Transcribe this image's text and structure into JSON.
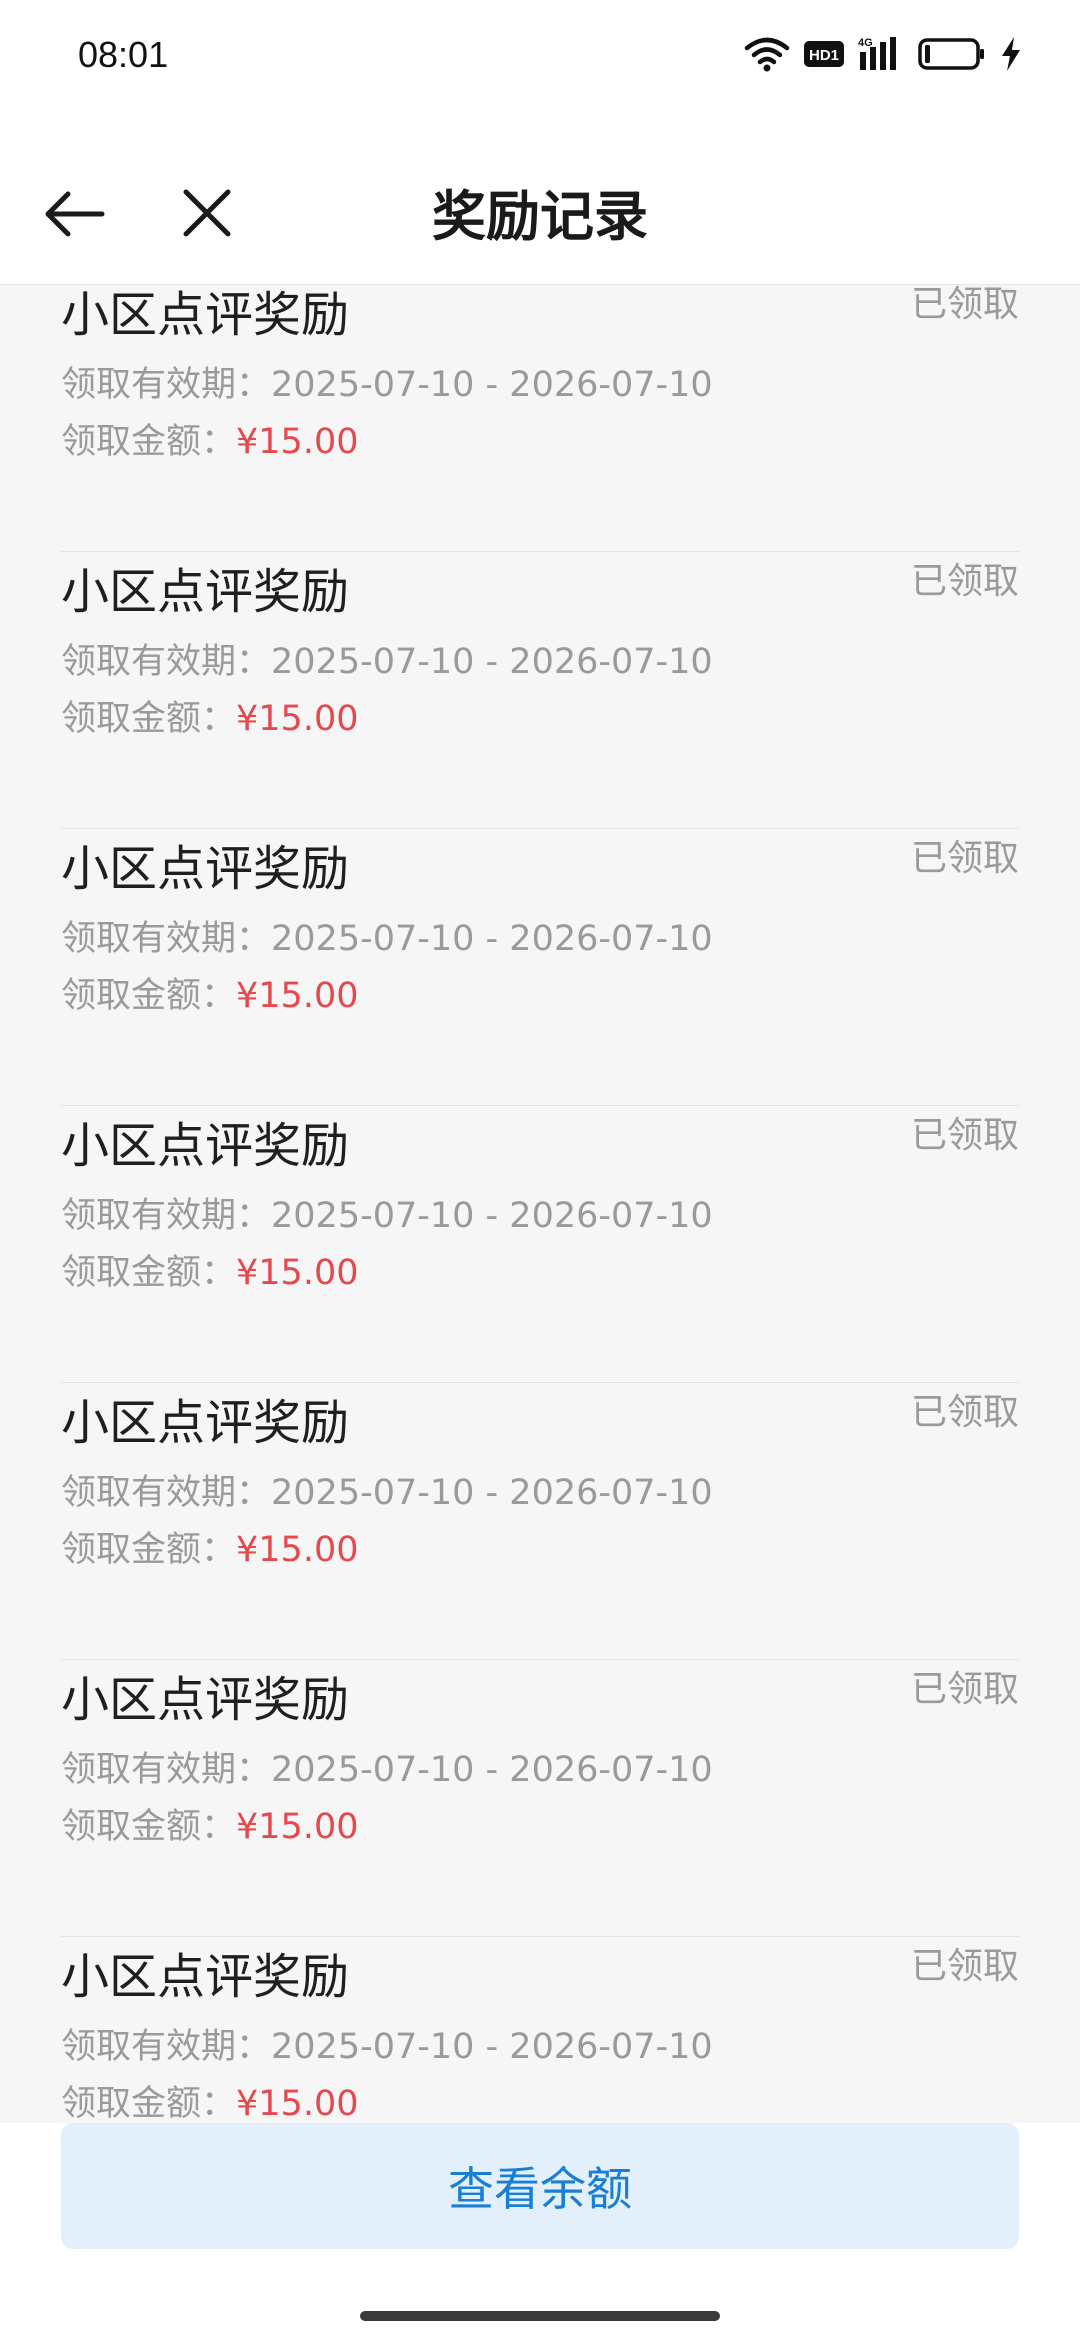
{
  "status": {
    "time": "08:01",
    "hd_label": "HD1",
    "network_label": "4G"
  },
  "header": {
    "title": "奖励记录"
  },
  "records": [
    {
      "title": "小区点评奖励",
      "status": "已领取",
      "validity_label": "领取有效期：",
      "validity": "2025-07-10 - 2026-07-10",
      "amount_label": "领取金额：",
      "amount": "¥15.00"
    },
    {
      "title": "小区点评奖励",
      "status": "已领取",
      "validity_label": "领取有效期：",
      "validity": "2025-07-10 - 2026-07-10",
      "amount_label": "领取金额：",
      "amount": "¥15.00"
    },
    {
      "title": "小区点评奖励",
      "status": "已领取",
      "validity_label": "领取有效期：",
      "validity": "2025-07-10 - 2026-07-10",
      "amount_label": "领取金额：",
      "amount": "¥15.00"
    },
    {
      "title": "小区点评奖励",
      "status": "已领取",
      "validity_label": "领取有效期：",
      "validity": "2025-07-10 - 2026-07-10",
      "amount_label": "领取金额：",
      "amount": "¥15.00"
    },
    {
      "title": "小区点评奖励",
      "status": "已领取",
      "validity_label": "领取有效期：",
      "validity": "2025-07-10 - 2026-07-10",
      "amount_label": "领取金额：",
      "amount": "¥15.00"
    },
    {
      "title": "小区点评奖励",
      "status": "已领取",
      "validity_label": "领取有效期：",
      "validity": "2025-07-10 - 2026-07-10",
      "amount_label": "领取金额：",
      "amount": "¥15.00"
    },
    {
      "title": "小区点评奖励",
      "status": "已领取",
      "validity_label": "领取有效期：",
      "validity": "2025-07-10 - 2026-07-10",
      "amount_label": "领取金额：",
      "amount": "¥15.00"
    }
  ],
  "footer": {
    "balance_button": "查看余额"
  },
  "colors": {
    "amount": "#e5484d",
    "button_bg": "#e3effb",
    "button_text": "#1a7fd4"
  },
  "icons": {
    "back": "arrow-left-icon",
    "close": "close-icon",
    "wifi": "wifi-icon",
    "signal": "signal-icon",
    "battery": "battery-icon",
    "charging": "charging-icon"
  }
}
